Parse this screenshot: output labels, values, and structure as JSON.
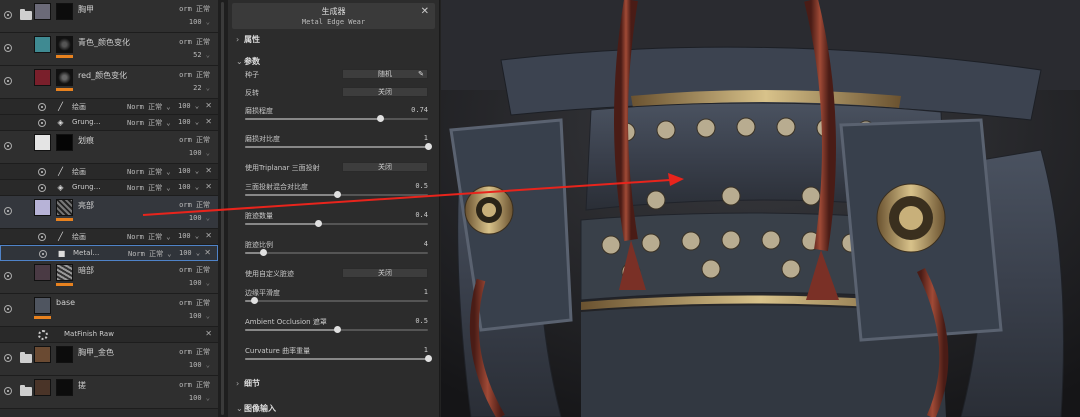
{
  "layers": [
    {
      "id": "l1",
      "name": "胸甲",
      "blend": "orm 正常",
      "opacity": "100",
      "folder": true,
      "thumb": "#6b6a78",
      "mask": "#111"
    },
    {
      "id": "l2",
      "name": "青色_颜色变化",
      "blend": "orm 正常",
      "opacity": "52",
      "folder": false,
      "thumb": "#3f8a92",
      "mask": "#151515"
    },
    {
      "id": "l3",
      "name": "red_颜色变化",
      "blend": "orm 正常",
      "opacity": "22",
      "folder": false,
      "thumb": "#7a1f2b",
      "mask": "#151515"
    },
    {
      "id": "l4",
      "name": "划痕",
      "blend": "orm 正常",
      "opacity": "100",
      "folder": false,
      "thumb": "#e4e4e4",
      "mask": "#050505"
    },
    {
      "id": "l5",
      "name": "亮部",
      "blend": "orm 正常",
      "opacity": "100",
      "folder": false,
      "thumb": "#b7b3d7",
      "mask": "#222"
    },
    {
      "id": "l6",
      "name": "暗部",
      "blend": "orm 正常",
      "opacity": "100",
      "folder": false,
      "thumb": "#4a3a44",
      "mask": "#333"
    },
    {
      "id": "l7",
      "name": "base",
      "blend": "orm 正常",
      "opacity": "100",
      "folder": false,
      "thumb": "#4f5560",
      "mask": "none"
    },
    {
      "id": "l8",
      "name": "胸甲_金色",
      "blend": "orm 正常",
      "opacity": "100",
      "folder": true,
      "thumb": "#6a4a32",
      "mask": "#111"
    },
    {
      "id": "l9",
      "name": "搓",
      "blend": "orm 正常",
      "opacity": "100",
      "folder": true,
      "thumb": "#4a3428",
      "mask": "#111"
    }
  ],
  "sublayers": {
    "paint_label": "绘画",
    "grunge_label": "Grung…",
    "metal_label": "Metal…",
    "sub_blend": "Norm 正常",
    "sub_opacity": "100",
    "close": "✕"
  },
  "material": {
    "name": "MatFinish Raw"
  },
  "props": {
    "title": "生成器",
    "subtitle": "Metal Edge Wear",
    "close": "✕",
    "section_attr": "属性",
    "section_params": "参数",
    "section_detail": "细节",
    "section_input": "图像输入",
    "params": [
      {
        "label": "种子",
        "kind": "button",
        "text": "随机",
        "pen": "✎"
      },
      {
        "label": "反转",
        "kind": "button",
        "text": "关闭"
      },
      {
        "label": "磨损程度",
        "kind": "slider",
        "value": "0.74",
        "frac": 0.74
      },
      {
        "label": "磨损对比度",
        "kind": "slider",
        "value": "1",
        "frac": 1.0
      },
      {
        "label": "使用Triplanar 三面投射",
        "kind": "button",
        "text": "关闭"
      },
      {
        "label": "三面投射混合对比度",
        "kind": "slider",
        "value": "0.5",
        "frac": 0.5
      },
      {
        "label": "脏迹数量",
        "kind": "slider",
        "value": "0.4",
        "frac": 0.4
      },
      {
        "label": "脏迹比例",
        "kind": "slider",
        "value": "4",
        "frac": 0.1
      },
      {
        "label": "使用自定义脏迹",
        "kind": "button",
        "text": "关闭"
      },
      {
        "label": "边缘平滑度",
        "kind": "slider",
        "value": "1",
        "frac": 0.05
      },
      {
        "label": "Ambient Occlusion 遮罩",
        "kind": "slider",
        "value": "0.5",
        "frac": 0.5
      },
      {
        "label": "Curvature 曲率重量",
        "kind": "slider",
        "value": "1",
        "frac": 1.0
      }
    ]
  },
  "colors": {
    "orange": "#e8821f",
    "selection": "#4f83c8",
    "arrow": "#e8241c"
  }
}
